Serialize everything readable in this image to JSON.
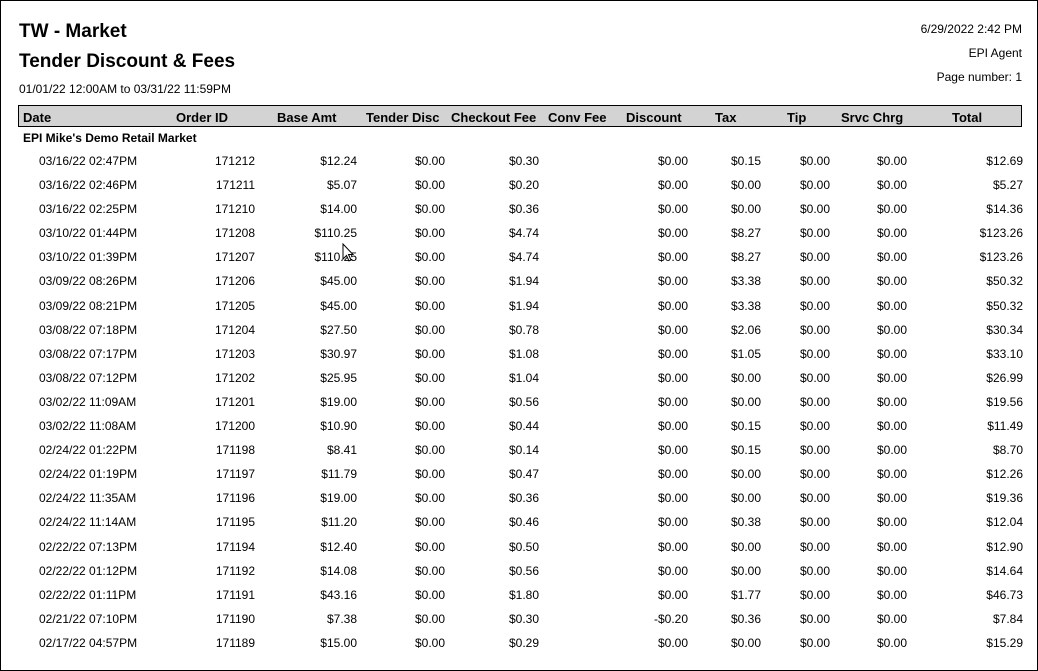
{
  "report": {
    "title": "TW - Market",
    "subtitle": "Tender Discount & Fees",
    "date_range": "01/01/22 12:00AM to 03/31/22 11:59PM",
    "printed": "6/29/2022 2:42 PM",
    "agent": "EPI Agent",
    "page_label": "Page number: 1"
  },
  "columns": [
    "Date",
    "Order ID",
    "Base Amt",
    "Tender Disc",
    "Checkout Fee",
    "Conv Fee",
    "Discount",
    "Tax",
    "Tip",
    "Srvc Chrg",
    "Total"
  ],
  "group_name": "EPI Mike's Demo Retail Market",
  "rows": [
    {
      "date": "03/16/22 02:47PM",
      "order": "171212",
      "base": "$12.24",
      "tdisc": "$0.00",
      "cfee": "$0.30",
      "conv": "",
      "disc": "$0.00",
      "tax": "$0.15",
      "tip": "$0.00",
      "srvc": "$0.00",
      "total": "$12.69"
    },
    {
      "date": "03/16/22 02:46PM",
      "order": "171211",
      "base": "$5.07",
      "tdisc": "$0.00",
      "cfee": "$0.20",
      "conv": "",
      "disc": "$0.00",
      "tax": "$0.00",
      "tip": "$0.00",
      "srvc": "$0.00",
      "total": "$5.27"
    },
    {
      "date": "03/16/22 02:25PM",
      "order": "171210",
      "base": "$14.00",
      "tdisc": "$0.00",
      "cfee": "$0.36",
      "conv": "",
      "disc": "$0.00",
      "tax": "$0.00",
      "tip": "$0.00",
      "srvc": "$0.00",
      "total": "$14.36"
    },
    {
      "date": "03/10/22 01:44PM",
      "order": "171208",
      "base": "$110.25",
      "tdisc": "$0.00",
      "cfee": "$4.74",
      "conv": "",
      "disc": "$0.00",
      "tax": "$8.27",
      "tip": "$0.00",
      "srvc": "$0.00",
      "total": "$123.26"
    },
    {
      "date": "03/10/22 01:39PM",
      "order": "171207",
      "base": "$110.25",
      "tdisc": "$0.00",
      "cfee": "$4.74",
      "conv": "",
      "disc": "$0.00",
      "tax": "$8.27",
      "tip": "$0.00",
      "srvc": "$0.00",
      "total": "$123.26"
    },
    {
      "date": "03/09/22 08:26PM",
      "order": "171206",
      "base": "$45.00",
      "tdisc": "$0.00",
      "cfee": "$1.94",
      "conv": "",
      "disc": "$0.00",
      "tax": "$3.38",
      "tip": "$0.00",
      "srvc": "$0.00",
      "total": "$50.32"
    },
    {
      "date": "03/09/22 08:21PM",
      "order": "171205",
      "base": "$45.00",
      "tdisc": "$0.00",
      "cfee": "$1.94",
      "conv": "",
      "disc": "$0.00",
      "tax": "$3.38",
      "tip": "$0.00",
      "srvc": "$0.00",
      "total": "$50.32"
    },
    {
      "date": "03/08/22 07:18PM",
      "order": "171204",
      "base": "$27.50",
      "tdisc": "$0.00",
      "cfee": "$0.78",
      "conv": "",
      "disc": "$0.00",
      "tax": "$2.06",
      "tip": "$0.00",
      "srvc": "$0.00",
      "total": "$30.34"
    },
    {
      "date": "03/08/22 07:17PM",
      "order": "171203",
      "base": "$30.97",
      "tdisc": "$0.00",
      "cfee": "$1.08",
      "conv": "",
      "disc": "$0.00",
      "tax": "$1.05",
      "tip": "$0.00",
      "srvc": "$0.00",
      "total": "$33.10"
    },
    {
      "date": "03/08/22 07:12PM",
      "order": "171202",
      "base": "$25.95",
      "tdisc": "$0.00",
      "cfee": "$1.04",
      "conv": "",
      "disc": "$0.00",
      "tax": "$0.00",
      "tip": "$0.00",
      "srvc": "$0.00",
      "total": "$26.99"
    },
    {
      "date": "03/02/22 11:09AM",
      "order": "171201",
      "base": "$19.00",
      "tdisc": "$0.00",
      "cfee": "$0.56",
      "conv": "",
      "disc": "$0.00",
      "tax": "$0.00",
      "tip": "$0.00",
      "srvc": "$0.00",
      "total": "$19.56"
    },
    {
      "date": "03/02/22 11:08AM",
      "order": "171200",
      "base": "$10.90",
      "tdisc": "$0.00",
      "cfee": "$0.44",
      "conv": "",
      "disc": "$0.00",
      "tax": "$0.15",
      "tip": "$0.00",
      "srvc": "$0.00",
      "total": "$11.49"
    },
    {
      "date": "02/24/22 01:22PM",
      "order": "171198",
      "base": "$8.41",
      "tdisc": "$0.00",
      "cfee": "$0.14",
      "conv": "",
      "disc": "$0.00",
      "tax": "$0.15",
      "tip": "$0.00",
      "srvc": "$0.00",
      "total": "$8.70"
    },
    {
      "date": "02/24/22 01:19PM",
      "order": "171197",
      "base": "$11.79",
      "tdisc": "$0.00",
      "cfee": "$0.47",
      "conv": "",
      "disc": "$0.00",
      "tax": "$0.00",
      "tip": "$0.00",
      "srvc": "$0.00",
      "total": "$12.26"
    },
    {
      "date": "02/24/22 11:35AM",
      "order": "171196",
      "base": "$19.00",
      "tdisc": "$0.00",
      "cfee": "$0.36",
      "conv": "",
      "disc": "$0.00",
      "tax": "$0.00",
      "tip": "$0.00",
      "srvc": "$0.00",
      "total": "$19.36"
    },
    {
      "date": "02/24/22 11:14AM",
      "order": "171195",
      "base": "$11.20",
      "tdisc": "$0.00",
      "cfee": "$0.46",
      "conv": "",
      "disc": "$0.00",
      "tax": "$0.38",
      "tip": "$0.00",
      "srvc": "$0.00",
      "total": "$12.04"
    },
    {
      "date": "02/22/22 07:13PM",
      "order": "171194",
      "base": "$12.40",
      "tdisc": "$0.00",
      "cfee": "$0.50",
      "conv": "",
      "disc": "$0.00",
      "tax": "$0.00",
      "tip": "$0.00",
      "srvc": "$0.00",
      "total": "$12.90"
    },
    {
      "date": "02/22/22 01:12PM",
      "order": "171192",
      "base": "$14.08",
      "tdisc": "$0.00",
      "cfee": "$0.56",
      "conv": "",
      "disc": "$0.00",
      "tax": "$0.00",
      "tip": "$0.00",
      "srvc": "$0.00",
      "total": "$14.64"
    },
    {
      "date": "02/22/22 01:11PM",
      "order": "171191",
      "base": "$43.16",
      "tdisc": "$0.00",
      "cfee": "$1.80",
      "conv": "",
      "disc": "$0.00",
      "tax": "$1.77",
      "tip": "$0.00",
      "srvc": "$0.00",
      "total": "$46.73"
    },
    {
      "date": "02/21/22 07:10PM",
      "order": "171190",
      "base": "$7.38",
      "tdisc": "$0.00",
      "cfee": "$0.30",
      "conv": "",
      "disc": "-$0.20",
      "tax": "$0.36",
      "tip": "$0.00",
      "srvc": "$0.00",
      "total": "$7.84"
    },
    {
      "date": "02/17/22 04:57PM",
      "order": "171189",
      "base": "$15.00",
      "tdisc": "$0.00",
      "cfee": "$0.29",
      "conv": "",
      "disc": "$0.00",
      "tax": "$0.00",
      "tip": "$0.00",
      "srvc": "$0.00",
      "total": "$15.29"
    }
  ],
  "cursor": {
    "icon": "mouse-pointer-icon"
  }
}
